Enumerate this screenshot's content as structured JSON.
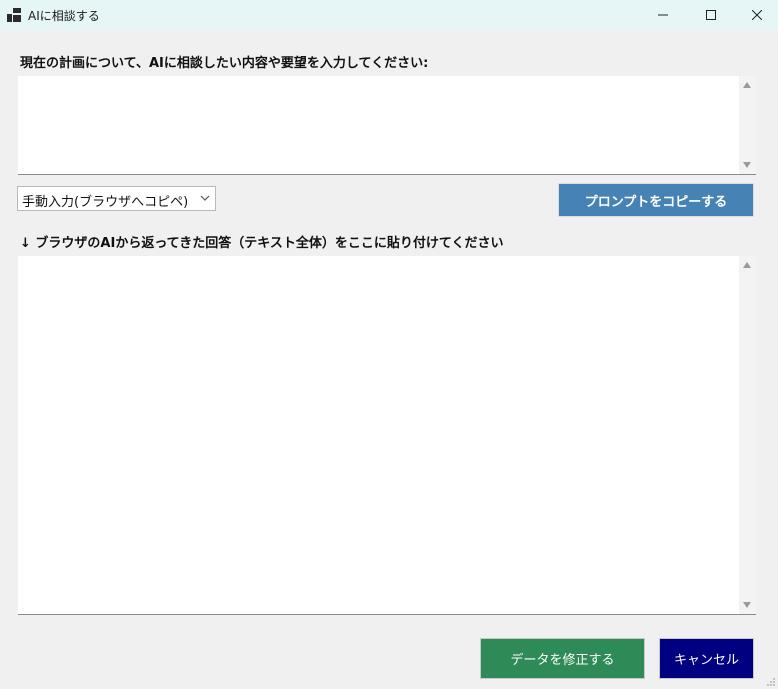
{
  "window": {
    "title": "AIに相談する",
    "app_icon": "app-window-icon",
    "controls": [
      "minimize-icon",
      "maximize-icon",
      "close-icon"
    ]
  },
  "prompt_section": {
    "label": "現在の計画について、AIに相談したい内容や要望を入力してください:",
    "value": ""
  },
  "mode_select": {
    "selected": "手動入力(ブラウザへコピペ)"
  },
  "copy_button": {
    "label": "プロンプトをコピーする"
  },
  "response_section": {
    "label": "↓ ブラウザのAIから返ってきた回答（テキスト全体）をここに貼り付けてください",
    "value": ""
  },
  "footer": {
    "apply_label": "データを修正する",
    "cancel_label": "キャンセル"
  },
  "colors": {
    "titlebar": "#e6f5f5",
    "window_bg": "#f0f0f0",
    "copy_button": "#4682b4",
    "apply_button": "#2e8b57",
    "cancel_button": "#000080"
  }
}
